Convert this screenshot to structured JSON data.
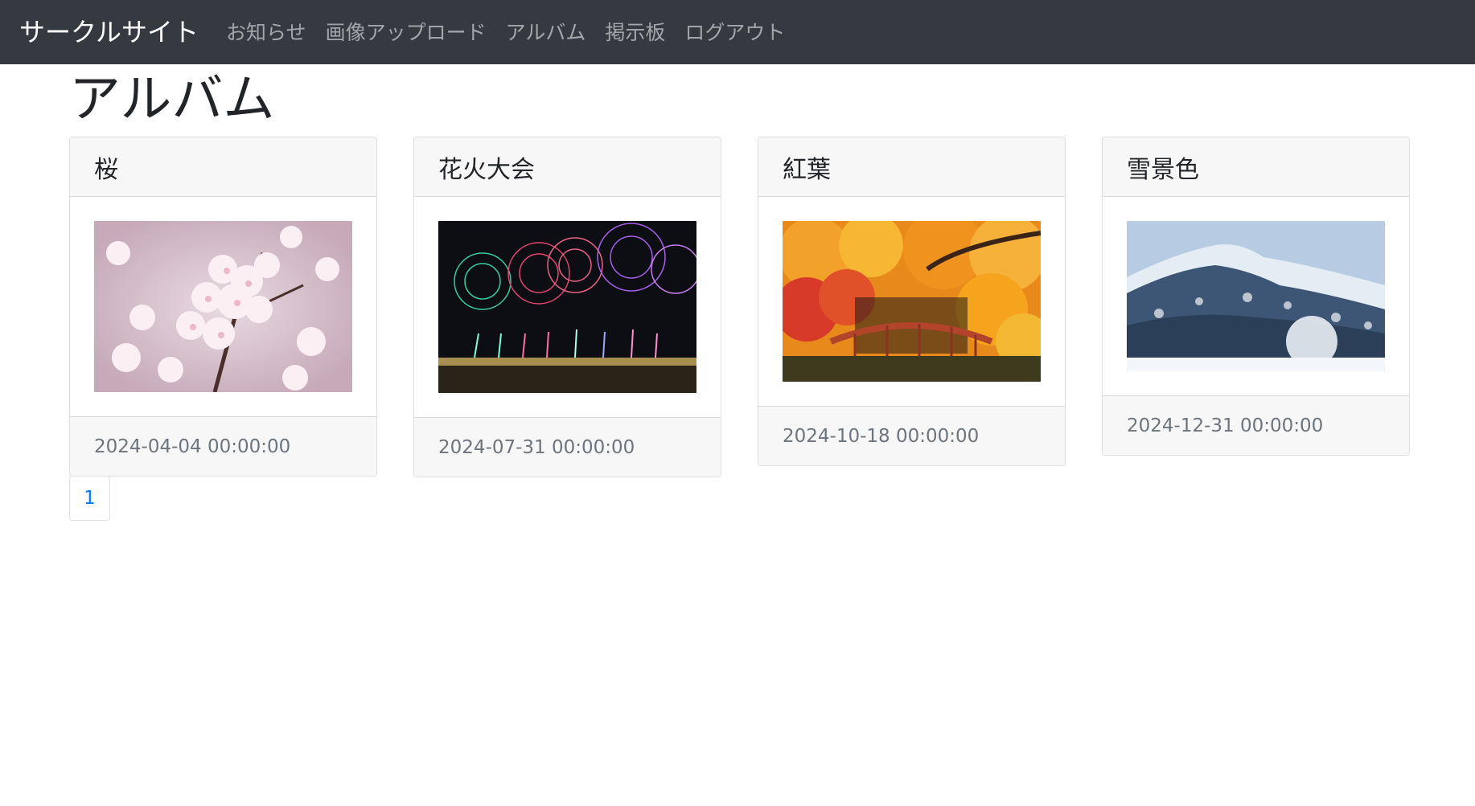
{
  "navbar": {
    "brand": "サークルサイト",
    "items": [
      {
        "label": "お知らせ"
      },
      {
        "label": "画像アップロード"
      },
      {
        "label": "アルバム"
      },
      {
        "label": "掲示板"
      },
      {
        "label": "ログアウト"
      }
    ]
  },
  "page": {
    "title": "アルバム"
  },
  "albums": [
    {
      "title": "桜",
      "date": "2024-04-04 00:00:00",
      "image_alt": "cherry blossoms photo"
    },
    {
      "title": "花火大会",
      "date": "2024-07-31 00:00:00",
      "image_alt": "fireworks photo"
    },
    {
      "title": "紅葉",
      "date": "2024-10-18 00:00:00",
      "image_alt": "autumn leaves bridge photo"
    },
    {
      "title": "雪景色",
      "date": "2024-12-31 00:00:00",
      "image_alt": "snowy mountain photo"
    }
  ],
  "pagination": {
    "pages": [
      "1"
    ]
  },
  "colors": {
    "navbar_bg": "#343a40",
    "link_accent": "#007bff",
    "card_header_bg": "#f7f7f7",
    "footer_text": "#6c757d"
  }
}
